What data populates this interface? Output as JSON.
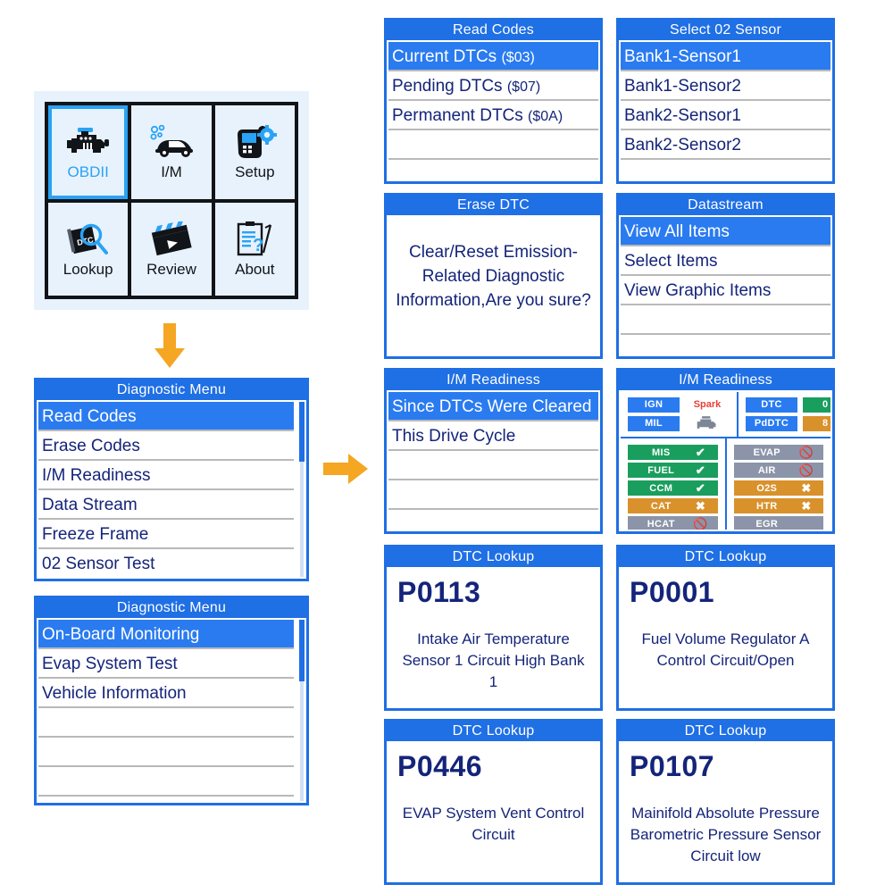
{
  "colors": {
    "panel_blue": "#1f6fe5",
    "select_blue": "#2a7bf0",
    "text_navy": "#14247a",
    "arrow_orange": "#f5a623",
    "ok_green": "#1a9e5e",
    "warn_orange": "#d9912b",
    "na_gray": "#8b94a8",
    "home_bg": "#e8f2fd",
    "accent_cyan": "#29a3f5",
    "spark_red": "#e8403a"
  },
  "home": {
    "tiles": [
      {
        "label": "OBDII",
        "icon": "engine-icon",
        "active": true
      },
      {
        "label": "I/M",
        "icon": "car-emission-icon",
        "active": false
      },
      {
        "label": "Setup",
        "icon": "scantool-gear-icon",
        "active": false
      },
      {
        "label": "Lookup",
        "icon": "dtc-magnifier-icon",
        "active": false
      },
      {
        "label": "Review",
        "icon": "clapperboard-play-icon",
        "active": false
      },
      {
        "label": "About",
        "icon": "clipboard-question-icon",
        "active": false
      }
    ]
  },
  "arrows": {
    "down": "arrow-down-icon",
    "right": "arrow-right-icon"
  },
  "panels": {
    "diag_menu_1": {
      "title": "Diagnostic Menu",
      "scroll": {
        "thumb_top_pct": 0,
        "thumb_height_pct": 34
      },
      "items": [
        {
          "label": "Read Codes",
          "selected": true
        },
        {
          "label": "Erase Codes",
          "selected": false
        },
        {
          "label": "I/M Readiness",
          "selected": false
        },
        {
          "label": "Data Stream",
          "selected": false
        },
        {
          "label": "Freeze Frame",
          "selected": false
        },
        {
          "label": "02 Sensor Test",
          "selected": false
        }
      ]
    },
    "diag_menu_2": {
      "title": "Diagnostic Menu",
      "scroll": {
        "thumb_top_pct": 0,
        "thumb_height_pct": 34
      },
      "items": [
        {
          "label": "On-Board Monitoring",
          "selected": true
        },
        {
          "label": "Evap System Test",
          "selected": false
        },
        {
          "label": "Vehicle Information",
          "selected": false
        },
        {
          "label": "",
          "selected": false
        },
        {
          "label": "",
          "selected": false
        },
        {
          "label": "",
          "selected": false
        }
      ]
    },
    "read_codes": {
      "title": "Read Codes",
      "items": [
        {
          "label": "Current DTCs ",
          "sub": "($03)",
          "selected": true
        },
        {
          "label": "Pending DTCs ",
          "sub": "($07)",
          "selected": false
        },
        {
          "label": "Permanent DTCs ",
          "sub": "($0A)",
          "selected": false
        },
        {
          "label": "",
          "sub": "",
          "selected": false
        },
        {
          "label": "",
          "sub": "",
          "selected": false
        }
      ]
    },
    "select_o2": {
      "title": "Select 02 Sensor",
      "items": [
        {
          "label": "Bank1-Sensor1",
          "selected": true
        },
        {
          "label": "Bank1-Sensor2",
          "selected": false
        },
        {
          "label": "Bank2-Sensor1",
          "selected": false
        },
        {
          "label": "Bank2-Sensor2",
          "selected": false
        },
        {
          "label": "",
          "selected": false
        }
      ]
    },
    "erase_dtc": {
      "title": "Erase DTC",
      "message": "Clear/Reset Emission-Related Diagnostic Information,Are you sure?"
    },
    "datastream": {
      "title": "Datastream",
      "items": [
        {
          "label": "View All Items",
          "selected": true
        },
        {
          "label": "Select Items",
          "selected": false
        },
        {
          "label": "View Graphic Items",
          "selected": false
        },
        {
          "label": "",
          "selected": false
        },
        {
          "label": "",
          "selected": false
        }
      ]
    },
    "im_readiness_menu": {
      "title": "I/M Readiness",
      "items": [
        {
          "label": "Since DTCs Were Cleared",
          "selected": true
        },
        {
          "label": "This Drive Cycle",
          "selected": false
        },
        {
          "label": "",
          "selected": false
        },
        {
          "label": "",
          "selected": false
        },
        {
          "label": "",
          "selected": false
        }
      ]
    },
    "im_readiness_status": {
      "title": "I/M Readiness",
      "top_left": [
        {
          "key": "IGN",
          "value": "Spark",
          "style": "plain"
        },
        {
          "key": "MIL",
          "value": "",
          "style": "engine-icon"
        }
      ],
      "top_right": [
        {
          "key": "DTC",
          "value": "0",
          "style": "green"
        },
        {
          "key": "PdDTC",
          "value": "8",
          "style": "orange"
        }
      ],
      "monitors_left": [
        {
          "name": "MIS",
          "state": "ok",
          "icon": "check-icon"
        },
        {
          "name": "FUEL",
          "state": "ok",
          "icon": "check-icon"
        },
        {
          "name": "CCM",
          "state": "ok",
          "icon": "check-icon"
        },
        {
          "name": "CAT",
          "state": "bad",
          "icon": "cross-icon"
        },
        {
          "name": "HCAT",
          "state": "na",
          "icon": "no-entry-icon"
        }
      ],
      "monitors_right": [
        {
          "name": "EVAP",
          "state": "na",
          "icon": "no-entry-icon"
        },
        {
          "name": "AIR",
          "state": "na",
          "icon": "no-entry-icon"
        },
        {
          "name": "O2S",
          "state": "bad",
          "icon": "cross-icon"
        },
        {
          "name": "HTR",
          "state": "bad",
          "icon": "cross-icon"
        },
        {
          "name": "EGR",
          "state": "na",
          "icon": "none"
        }
      ]
    },
    "dtc_lookup_1": {
      "title": "DTC Lookup",
      "code": "P0113",
      "description": "Intake Air Temperature Sensor 1 Circuit High Bank 1"
    },
    "dtc_lookup_2": {
      "title": "DTC Lookup",
      "code": "P0001",
      "description": "Fuel Volume Regulator A Control Circuit/Open"
    },
    "dtc_lookup_3": {
      "title": "DTC Lookup",
      "code": "P0446",
      "description": "EVAP System Vent Control Circuit"
    },
    "dtc_lookup_4": {
      "title": "DTC Lookup",
      "code": "P0107",
      "description": "Mainifold Absolute Pressure Barometric Pressure Sensor Circuit low"
    }
  }
}
